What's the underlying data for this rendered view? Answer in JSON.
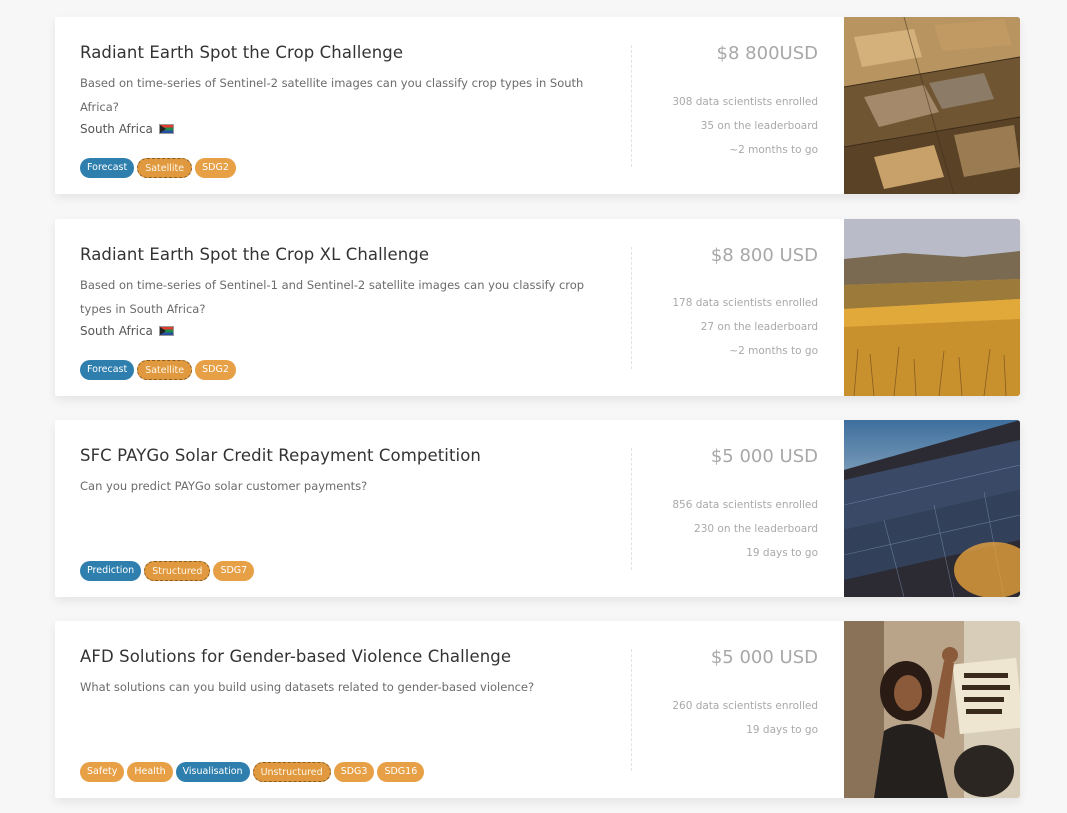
{
  "competitions": [
    {
      "title": "Radiant Earth Spot the Crop Challenge",
      "description": "Based on time-series of Sentinel-2 satellite images can you classify crop types in South Africa?",
      "country": "South Africa",
      "prize": "$8 800USD",
      "enrolled": "308 data scientists enrolled",
      "leaderboard": "35 on the leaderboard",
      "time_left": "~2 months to go",
      "tags": [
        "Forecast",
        "Satellite",
        "SDG2"
      ],
      "image": "farmland-aerial-image"
    },
    {
      "title": "Radiant Earth Spot the Crop XL Challenge",
      "description": "Based on time-series of Sentinel-1 and Sentinel-2 satellite images can you classify crop types in South Africa?",
      "country": "South Africa",
      "prize": "$8 800 USD",
      "enrolled": "178 data scientists enrolled",
      "leaderboard": "27 on the leaderboard",
      "time_left": "~2 months to go",
      "tags": [
        "Forecast",
        "Satellite",
        "SDG2"
      ],
      "image": "wheat-field-image"
    },
    {
      "title": "SFC PAYGo Solar Credit Repayment Competition",
      "description": "Can you predict PAYGo solar customer payments?",
      "country": "",
      "prize": "$5 000 USD",
      "enrolled": "856 data scientists enrolled",
      "leaderboard": "230 on the leaderboard",
      "time_left": "19 days to go",
      "tags": [
        "Prediction",
        "Structured",
        "SDG7"
      ],
      "image": "solar-panel-image"
    },
    {
      "title": "AFD Solutions for Gender-based Violence Challenge",
      "description": "What solutions can you build using datasets related to gender-based violence?",
      "country": "",
      "prize": "$5 000 USD",
      "enrolled": "260 data scientists enrolled",
      "leaderboard": "",
      "time_left": "19 days to go",
      "tags": [
        "Safety",
        "Health",
        "Visualisation",
        "Unstructured",
        "SDG3",
        "SDG16"
      ],
      "image": "protest-image"
    }
  ],
  "colors": {
    "tag_blue": "#2e7fae",
    "tag_orange": "#e7a046"
  }
}
